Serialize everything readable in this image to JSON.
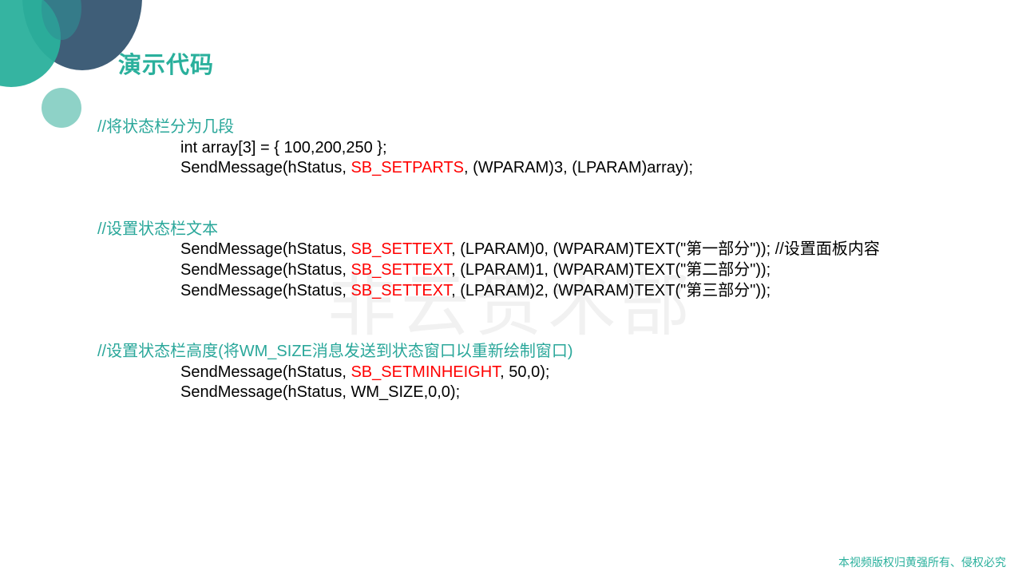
{
  "slide": {
    "title": "演示代码",
    "watermark": "非云贵术部",
    "footer": "本视频版权归黄强所有、侵权必究",
    "accent_color": "#2ab09c",
    "highlight_color": "#ff0000"
  },
  "blocks": [
    {
      "comment": "//将状态栏分为几段",
      "lines": [
        {
          "pre": "int array[3] = { 100,200,250 };",
          "kw": "",
          "post": ""
        },
        {
          "pre": "SendMessage(hStatus, ",
          "kw": "SB_SETPARTS",
          "post": ", (WPARAM)3, (LPARAM)array);"
        }
      ]
    },
    {
      "comment": "//设置状态栏文本",
      "lines": [
        {
          "pre": "SendMessage(hStatus, ",
          "kw": "SB_SETTEXT",
          "post": ", (LPARAM)0, (WPARAM)TEXT(\"第一部分\")); //设置面板内容"
        },
        {
          "pre": "SendMessage(hStatus, ",
          "kw": "SB_SETTEXT",
          "post": ", (LPARAM)1, (WPARAM)TEXT(\"第二部分\"));"
        },
        {
          "pre": "SendMessage(hStatus, ",
          "kw": "SB_SETTEXT",
          "post": ", (LPARAM)2, (WPARAM)TEXT(\"第三部分\"));"
        }
      ]
    },
    {
      "comment": "//设置状态栏高度(将WM_SIZE消息发送到状态窗口以重新绘制窗口)",
      "lines": [
        {
          "pre": "SendMessage(hStatus, ",
          "kw": "SB_SETMINHEIGHT",
          "post": ", 50,0);"
        },
        {
          "pre": "SendMessage(hStatus, WM_SIZE,0,0);",
          "kw": "",
          "post": ""
        }
      ]
    }
  ]
}
